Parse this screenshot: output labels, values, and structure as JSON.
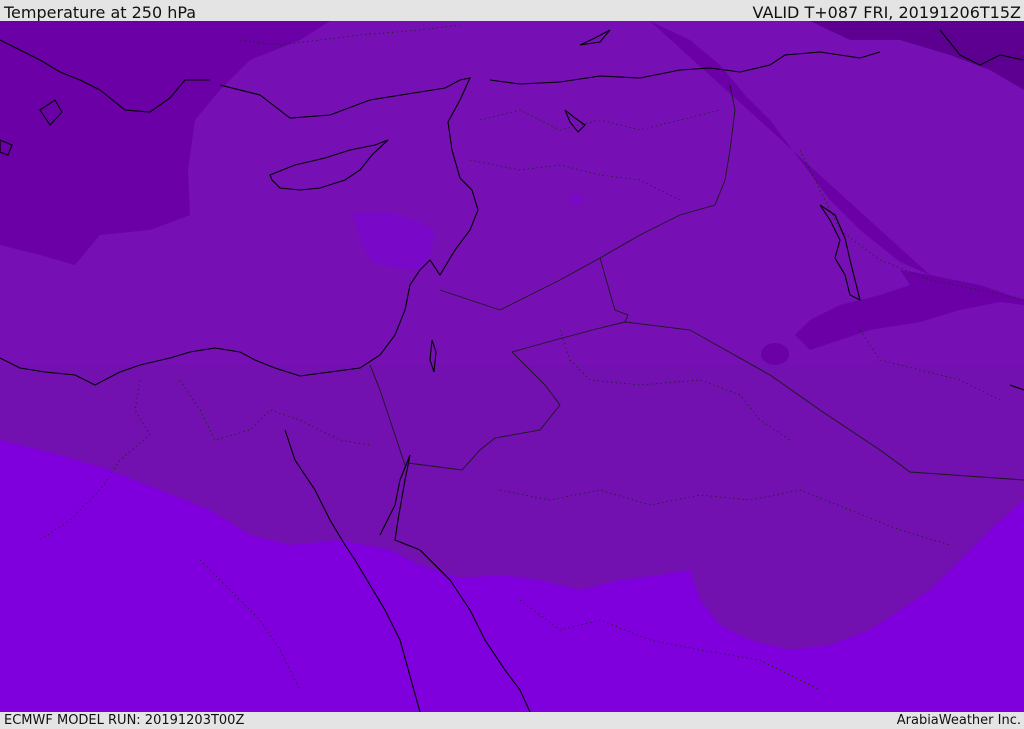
{
  "header": {
    "title": "Temperature at 250 hPa",
    "valid_time": "VALID T+087 FRI, 20191206T15Z"
  },
  "footer": {
    "model_run": "ECMWF MODEL RUN: 20191203T00Z",
    "credit": "ArabiaWeather Inc."
  },
  "map": {
    "colors": {
      "coldest": "#5d0092",
      "cold": "#6a00a6",
      "mid": "#7610b4",
      "warm": "#7a08c8",
      "warmest": "#7f00dd",
      "coast": "#000000",
      "border": "#1a1a1a"
    }
  }
}
